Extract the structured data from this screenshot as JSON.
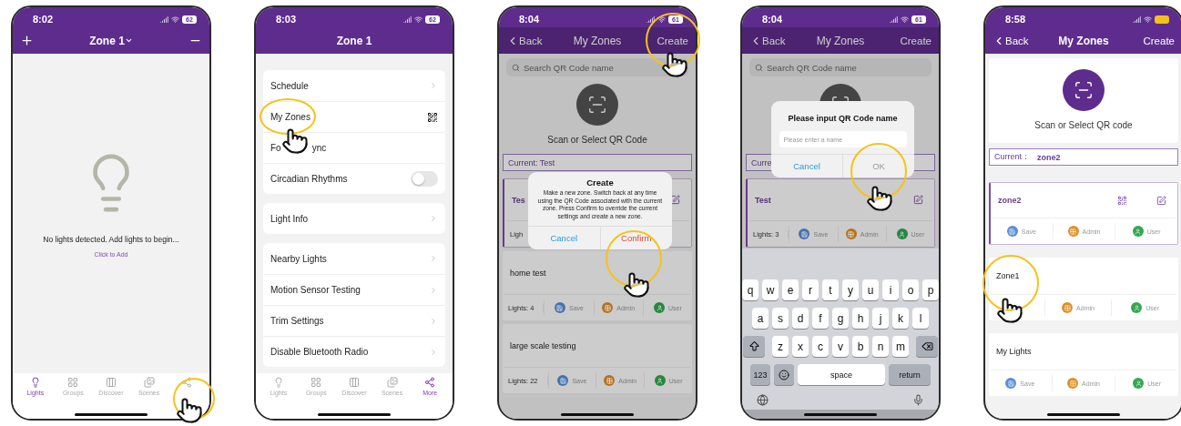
{
  "screens": [
    {
      "kind": "empty",
      "status": {
        "time": "8:02",
        "battery": "62"
      },
      "nav": {
        "title": "Zone 1",
        "dropdown": true
      },
      "message": "No lights detected. Add lights to begin...",
      "link": "Click to Add",
      "tabs": [
        {
          "kind": "lights",
          "label": "Lights",
          "selected": true
        },
        {
          "kind": "groups",
          "label": "Groups",
          "selected": false
        },
        {
          "kind": "discover",
          "label": "Discover",
          "selected": false
        },
        {
          "kind": "scenes",
          "label": "Scenes",
          "selected": false
        },
        {
          "kind": "more",
          "selected": false
        }
      ]
    },
    {
      "kind": "menu",
      "status": {
        "time": "8:03",
        "battery": "62"
      },
      "nav": {
        "title": "Zone 1",
        "dropdown": false
      },
      "groups": [
        [
          {
            "kind": "chevron",
            "label": "Schedule"
          },
          {
            "kind": "qr",
            "label": "My Zones"
          },
          {
            "kind": "plain",
            "label_parts": [
              "Fo",
              "ync"
            ]
          },
          {
            "kind": "toggle",
            "label": "Circadian Rhythms",
            "on": false
          }
        ],
        [
          {
            "kind": "chevron",
            "label": "Light Info"
          }
        ],
        [
          {
            "kind": "chevron",
            "label": "Nearby Lights"
          },
          {
            "kind": "chevron",
            "label": "Motion Sensor Testing"
          },
          {
            "kind": "chevron",
            "label": "Trim Settings"
          },
          {
            "kind": "chevron",
            "label": "Disable Bluetooth Radio"
          }
        ]
      ],
      "tabs": [
        {
          "kind": "lights",
          "label": "Lights",
          "selected": false
        },
        {
          "kind": "groups",
          "label": "Groups",
          "selected": false
        },
        {
          "kind": "discover",
          "label": "Discover",
          "selected": false
        },
        {
          "kind": "scenes",
          "label": "Scenes",
          "selected": false
        },
        {
          "kind": "more",
          "label": "More",
          "selected": true
        }
      ]
    },
    {
      "kind": "zones",
      "status": {
        "time": "8:04",
        "battery": "61"
      },
      "nav": {
        "back": "Back",
        "title": "My Zones",
        "action": "Create"
      },
      "dimmed": true,
      "search": {
        "placeholder": "Search QR Code name"
      },
      "scan": {
        "label": "Scan or Select QR Code"
      },
      "current": {
        "label": "Current: Test"
      },
      "zones": [
        {
          "name": "Tes",
          "selected": true,
          "lights": "Ligh"
        },
        {
          "name": "home test",
          "selected": false,
          "lights": "Lights: 4",
          "actions": [
            {
              "kind": "save",
              "label": "Save",
              "color": "#4972ab"
            },
            {
              "kind": "admin",
              "label": "Admin",
              "color": "#b37322"
            },
            {
              "kind": "user",
              "label": "User",
              "color": "#298642"
            }
          ]
        },
        {
          "name": "large scale testing",
          "selected": false,
          "lights": "Lights: 22",
          "actions": [
            {
              "kind": "save",
              "label": "Save",
              "color": "#4972ab"
            },
            {
              "kind": "admin",
              "label": "Admin",
              "color": "#b37322"
            },
            {
              "kind": "user",
              "label": "User",
              "color": "#298642"
            }
          ]
        }
      ],
      "dialog": {
        "kind": "confirm",
        "title": "Create",
        "message": "Make a new zone. Switch back at any time using the QR Code associated with the current zone. Press Confirm to override the current settings and create a new zone.",
        "cancel": "Cancel",
        "confirm": "Confirm"
      }
    },
    {
      "kind": "zones",
      "status": {
        "time": "8:04",
        "battery": "61"
      },
      "nav": {
        "back": "Back",
        "title": "My Zones",
        "action": "Create"
      },
      "dimmed": true,
      "search": {
        "placeholder": "Search QR Code name"
      },
      "current": {
        "label": "Curre"
      },
      "zones": [
        {
          "name": "Test",
          "selected": true,
          "lights": "Lights: 3",
          "actions": [
            {
              "kind": "save",
              "label": "Save",
              "color": "#4972ab"
            },
            {
              "kind": "admin",
              "label": "Admin",
              "color": "#b37322"
            },
            {
              "kind": "user",
              "label": "User",
              "color": "#298642"
            }
          ]
        }
      ],
      "dialog": {
        "kind": "input",
        "title": "Please input QR Code name",
        "placeholder": "Please enter a name",
        "cancel": "Cancel",
        "confirm": "OK",
        "disabled": true
      },
      "keyboard": {
        "rows": [
          [
            "q",
            "w",
            "e",
            "r",
            "t",
            "y",
            "u",
            "i",
            "o",
            "p"
          ],
          [
            "a",
            "s",
            "d",
            "f",
            "g",
            "h",
            "j",
            "k",
            "l"
          ],
          [
            "z",
            "x",
            "c",
            "v",
            "b",
            "n",
            "m"
          ]
        ],
        "numbers": "123",
        "space": "space",
        "return": "return"
      }
    },
    {
      "kind": "zones",
      "status": {
        "time": "8:58"
      },
      "nav": {
        "back": "Back",
        "title": "My Zones",
        "action": "Create"
      },
      "dimmed": false,
      "scan": {
        "label": "Scan or Select QR code"
      },
      "current": {
        "label": "Current：",
        "value": "zone2"
      },
      "zones": [
        {
          "name": "zone2",
          "selected": true,
          "actions": [
            {
              "kind": "save",
              "label": "Save",
              "color": "#5b8fd6"
            },
            {
              "kind": "admin",
              "label": "Admin",
              "color": "#e0902a"
            },
            {
              "kind": "user",
              "label": "User",
              "color": "#33a852"
            }
          ]
        },
        {
          "name": "Zone1",
          "selected": false,
          "actions": [
            {
              "kind": "blank"
            },
            {
              "kind": "admin",
              "label": "Admin",
              "color": "#e0902a"
            },
            {
              "kind": "user",
              "label": "User",
              "color": "#33a852"
            }
          ]
        },
        {
          "name": "My Lights",
          "selected": false,
          "actions": [
            {
              "kind": "save",
              "label": "Save",
              "color": "#5b8fd6"
            },
            {
              "kind": "admin",
              "label": "Admin",
              "color": "#e0902a"
            },
            {
              "kind": "user",
              "label": "User",
              "color": "#33a852"
            }
          ]
        }
      ]
    }
  ]
}
